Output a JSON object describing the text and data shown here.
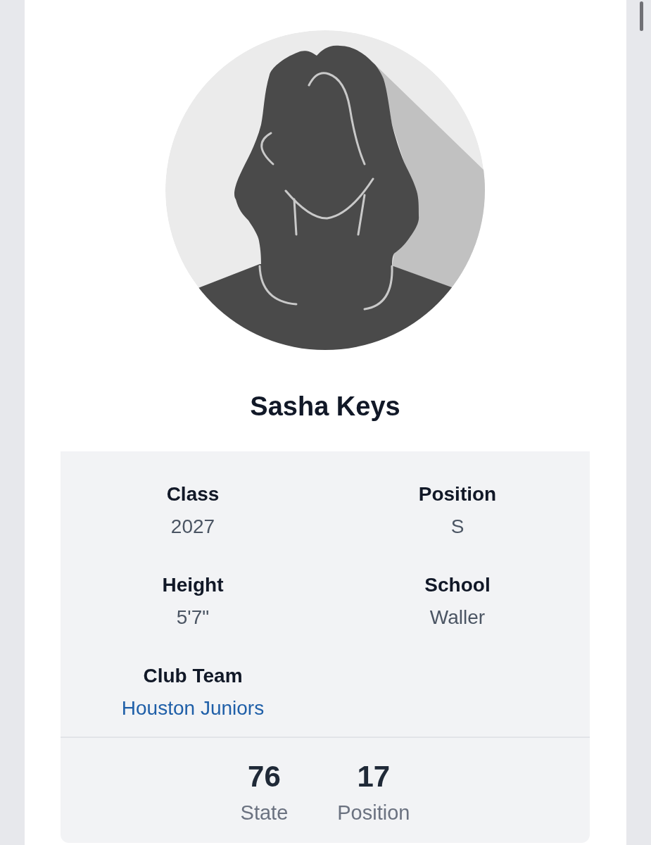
{
  "profile": {
    "name": "Sasha Keys"
  },
  "details": [
    {
      "label": "Class",
      "value": "2027",
      "kind": "text"
    },
    {
      "label": "Position",
      "value": "S",
      "kind": "text"
    },
    {
      "label": "Height",
      "value": "5'7\"",
      "kind": "text"
    },
    {
      "label": "School",
      "value": "Waller",
      "kind": "text"
    },
    {
      "label": "Club Team",
      "value": "Houston Juniors",
      "kind": "link"
    }
  ],
  "rankings": [
    {
      "value": "76",
      "label": "State"
    },
    {
      "value": "17",
      "label": "Position"
    }
  ]
}
